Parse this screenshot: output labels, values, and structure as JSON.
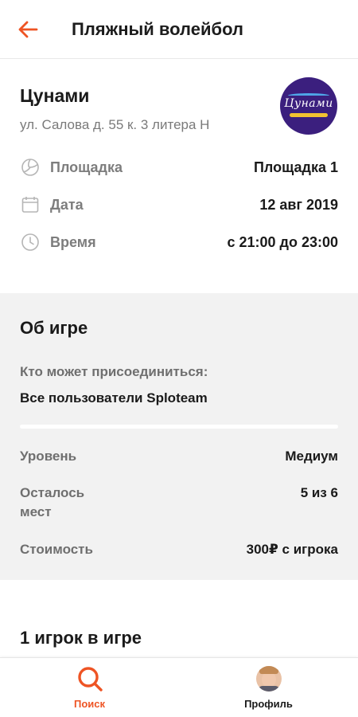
{
  "header": {
    "title": "Пляжный волейбол",
    "back_icon": "arrow-left-icon",
    "accent_color": "#ee5424"
  },
  "venue": {
    "name": "Цунами",
    "address": "ул. Салова д. 55 к. 3 литера Н",
    "logo_text": "Цунами",
    "logo_bg": "#3b1f7e"
  },
  "info": [
    {
      "icon": "volleyball-icon",
      "label": "Площадка",
      "value": "Площадка 1"
    },
    {
      "icon": "calendar-icon",
      "label": "Дата",
      "value": "12 авг 2019"
    },
    {
      "icon": "clock-icon",
      "label": "Время",
      "value": "с 21:00 до 23:00"
    }
  ],
  "about": {
    "title": "Об игре",
    "who_label": "Кто может присоединиться:",
    "who_value": "Все пользователи Sploteam",
    "details": [
      {
        "label": "Уровень",
        "value": "Медиум"
      },
      {
        "label": "Осталось мест",
        "value": "5 из 6"
      },
      {
        "label": "Стоимость",
        "value": "300₽ с игрока"
      }
    ]
  },
  "players": {
    "title": "1 игрок в игре"
  },
  "tabbar": {
    "search_label": "Поиск",
    "search_icon": "search-icon",
    "profile_label": "Профиль",
    "active_color": "#ee5424",
    "inactive_color": "#1a1a1a"
  }
}
